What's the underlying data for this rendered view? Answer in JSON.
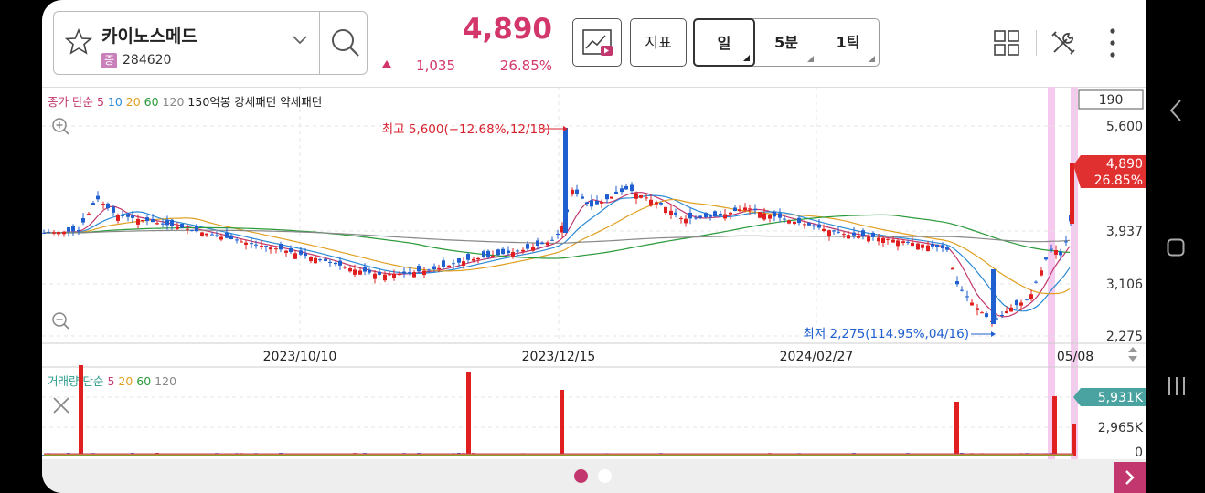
{
  "stock": {
    "name": "카이노스메드",
    "badge": "증",
    "code": "284620"
  },
  "quote": {
    "price": "4,890",
    "change": "1,035",
    "change_pct": "26.85%"
  },
  "toolbar": {
    "indicator_label": "지표",
    "periods": [
      {
        "label": "일",
        "active": true
      },
      {
        "label": "5분",
        "active": false
      },
      {
        "label": "1틱",
        "active": false
      }
    ]
  },
  "price_chart": {
    "legend": [
      {
        "text": "종가 단순",
        "color": "#c2376d"
      },
      {
        "text": "5",
        "color": "#c2376d"
      },
      {
        "text": "10",
        "color": "#2b8ad6"
      },
      {
        "text": "20",
        "color": "#e0a021"
      },
      {
        "text": "60",
        "color": "#2a9a3a"
      },
      {
        "text": "120",
        "color": "#888888"
      },
      {
        "text": "150억봉",
        "color": "#222222"
      },
      {
        "text": "강세패턴",
        "color": "#222222"
      },
      {
        "text": "약세패턴",
        "color": "#222222"
      }
    ],
    "count_box": "190",
    "y_ticks": [
      "5,600",
      "3,937",
      "3,106",
      "2,275"
    ],
    "current_price_tag": "4,890",
    "current_pct_tag": "26.85%",
    "high_label": "최고 5,600(−12.68%,12/18)",
    "low_label": "최저 2,275(114.95%,04/16)",
    "x_ticks": [
      "2023/10/10",
      "2023/12/15",
      "2024/02/27",
      "05/08"
    ]
  },
  "volume_chart": {
    "legend": [
      {
        "text": "거래량 단순",
        "color": "#2a9a8a"
      },
      {
        "text": "5",
        "color": "#c2376d"
      },
      {
        "text": "20",
        "color": "#e0a021"
      },
      {
        "text": "60",
        "color": "#2a9a3a"
      },
      {
        "text": "120",
        "color": "#888888"
      }
    ],
    "y_ticks": [
      "2,965K",
      "0"
    ],
    "current_volume_tag": "5,931K"
  },
  "colors": {
    "up": "#e02020",
    "down": "#1f5fcf",
    "accent": "#c2376d",
    "volume_tag": "#4aa3a0"
  },
  "icons": [
    "star-icon",
    "chevron-down-icon",
    "search-icon",
    "chart-play-icon",
    "grid-icon",
    "tools-icon",
    "more-vert-icon",
    "zoom-in-icon",
    "zoom-out-icon",
    "close-icon",
    "next-arrow-icon"
  ]
}
